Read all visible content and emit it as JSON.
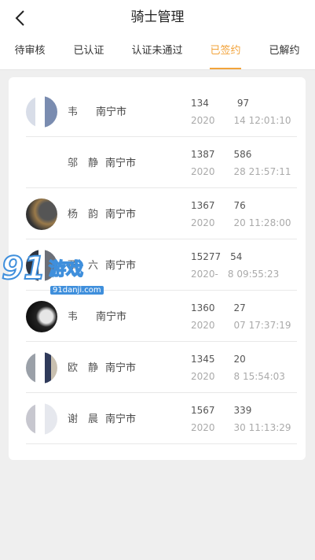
{
  "header": {
    "title": "骑士管理",
    "back_icon": "chevron-left-icon"
  },
  "tabs": [
    {
      "label": "待审核"
    },
    {
      "label": "已认证"
    },
    {
      "label": "认证未通过"
    },
    {
      "label": "已签约",
      "active": true
    },
    {
      "label": "已解约"
    }
  ],
  "colors": {
    "accent": "#f2a33a",
    "background": "#efefef"
  },
  "riders": [
    {
      "name": "韦",
      "city": "南宁市",
      "phone": "134　　　97",
      "date": "2020　　14 12:01:10"
    },
    {
      "name": "邬　静",
      "city": "南宁市",
      "phone": "1387　　586",
      "date": "2020　　28 21:57:11"
    },
    {
      "name": "杨　韵",
      "city": "南宁市",
      "phone": "1367　　76",
      "date": "2020　　20 11:28:00"
    },
    {
      "name": "覃　六",
      "city": "南宁市",
      "phone": "15277　54",
      "date": "2020-　8 09:55:23"
    },
    {
      "name": "韦",
      "city": "南宁市",
      "phone": "1360　　27",
      "date": "2020　　07 17:37:19"
    },
    {
      "name": "欧　静",
      "city": "南宁市",
      "phone": "1345　　20",
      "date": "2020　　8 15:54:03"
    },
    {
      "name": "谢　晨",
      "city": "南宁市",
      "phone": "1567　　339",
      "date": "2020　　30 11:13:29"
    }
  ],
  "watermark": {
    "number": "91",
    "text": "游戏",
    "url": "91danji.com"
  }
}
